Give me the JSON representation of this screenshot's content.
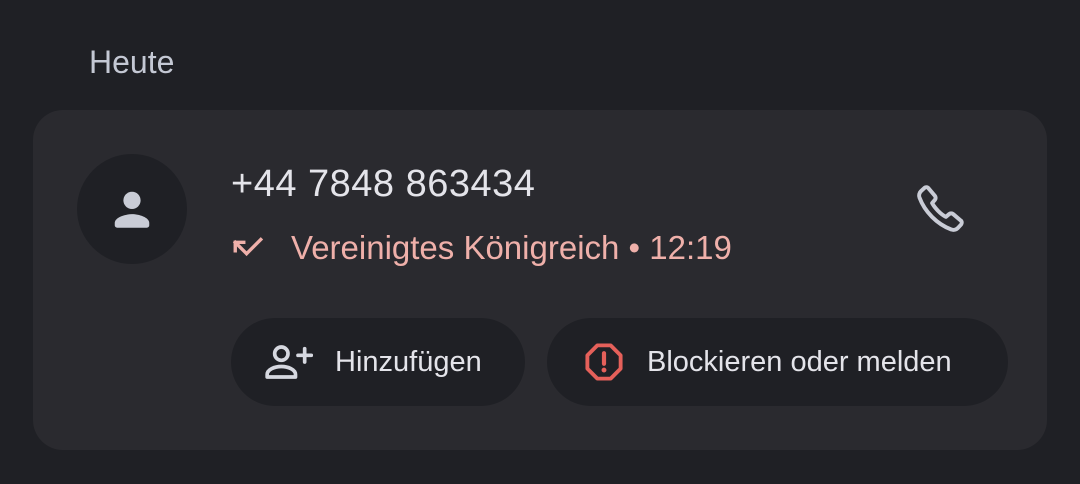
{
  "section": {
    "title": "Heute"
  },
  "call_entry": {
    "phone_number": "+44 7848 863434",
    "detail": "Vereinigtes Königreich • 12:19",
    "call_type_icon": "missed-call-icon",
    "avatar_icon": "person-icon",
    "call_icon": "phone-icon"
  },
  "actions": {
    "add_label": "Hinzufügen",
    "add_icon": "person-add-icon",
    "block_label": "Blockieren oder melden",
    "block_icon": "report-octagon-icon"
  },
  "colors": {
    "background": "#1f2025",
    "card": "#2a2a2f",
    "missed_text": "#efb0aa",
    "report_icon": "#e5605a",
    "primary_text": "#e4e4ea"
  }
}
